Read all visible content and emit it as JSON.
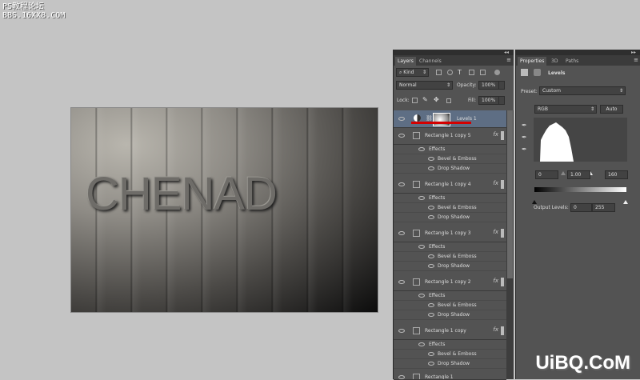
{
  "watermarks": {
    "top_line1": "PS教程论坛",
    "top_line2": "BBS.16XX8.COM",
    "bottom": "UiBQ.CoM"
  },
  "canvas": {
    "text": "CHENAD"
  },
  "layers_panel": {
    "tabs": [
      "Layers",
      "Channels"
    ],
    "filter_kind": "Kind",
    "blend_mode": "Normal",
    "opacity_label": "Opacity:",
    "opacity_value": "100%",
    "lock_label": "Lock:",
    "fill_label": "Fill:",
    "fill_value": "100%",
    "fx_label": "fx",
    "layers": [
      {
        "name": "Levels 1",
        "selected": true,
        "effects": []
      },
      {
        "name": "Rectangle 1 copy 5",
        "effects_label": "Effects",
        "effects": [
          "Bevel & Emboss",
          "Drop Shadow"
        ]
      },
      {
        "name": "Rectangle 1 copy 4",
        "effects_label": "Effects",
        "effects": [
          "Bevel & Emboss",
          "Drop Shadow"
        ]
      },
      {
        "name": "Rectangle 1 copy 3",
        "effects_label": "Effects",
        "effects": [
          "Bevel & Emboss",
          "Drop Shadow"
        ]
      },
      {
        "name": "Rectangle 1 copy 2",
        "effects_label": "Effects",
        "effects": [
          "Bevel & Emboss",
          "Drop Shadow"
        ]
      },
      {
        "name": "Rectangle 1 copy",
        "effects_label": "Effects",
        "effects": [
          "Bevel & Emboss",
          "Drop Shadow"
        ]
      },
      {
        "name": "Rectangle 1"
      }
    ]
  },
  "properties_panel": {
    "tabs": [
      "Properties",
      "3D",
      "Paths"
    ],
    "title": "Levels",
    "preset_label": "Preset:",
    "preset_value": "Custom",
    "channel": "RGB",
    "auto_label": "Auto",
    "input_black": "0",
    "input_gamma": "1.00",
    "input_white": "160",
    "output_label": "Output Levels:",
    "output_black": "0",
    "output_white": "255"
  },
  "colors": {
    "selection": "#5e6e84",
    "annotation": "#d40000"
  }
}
